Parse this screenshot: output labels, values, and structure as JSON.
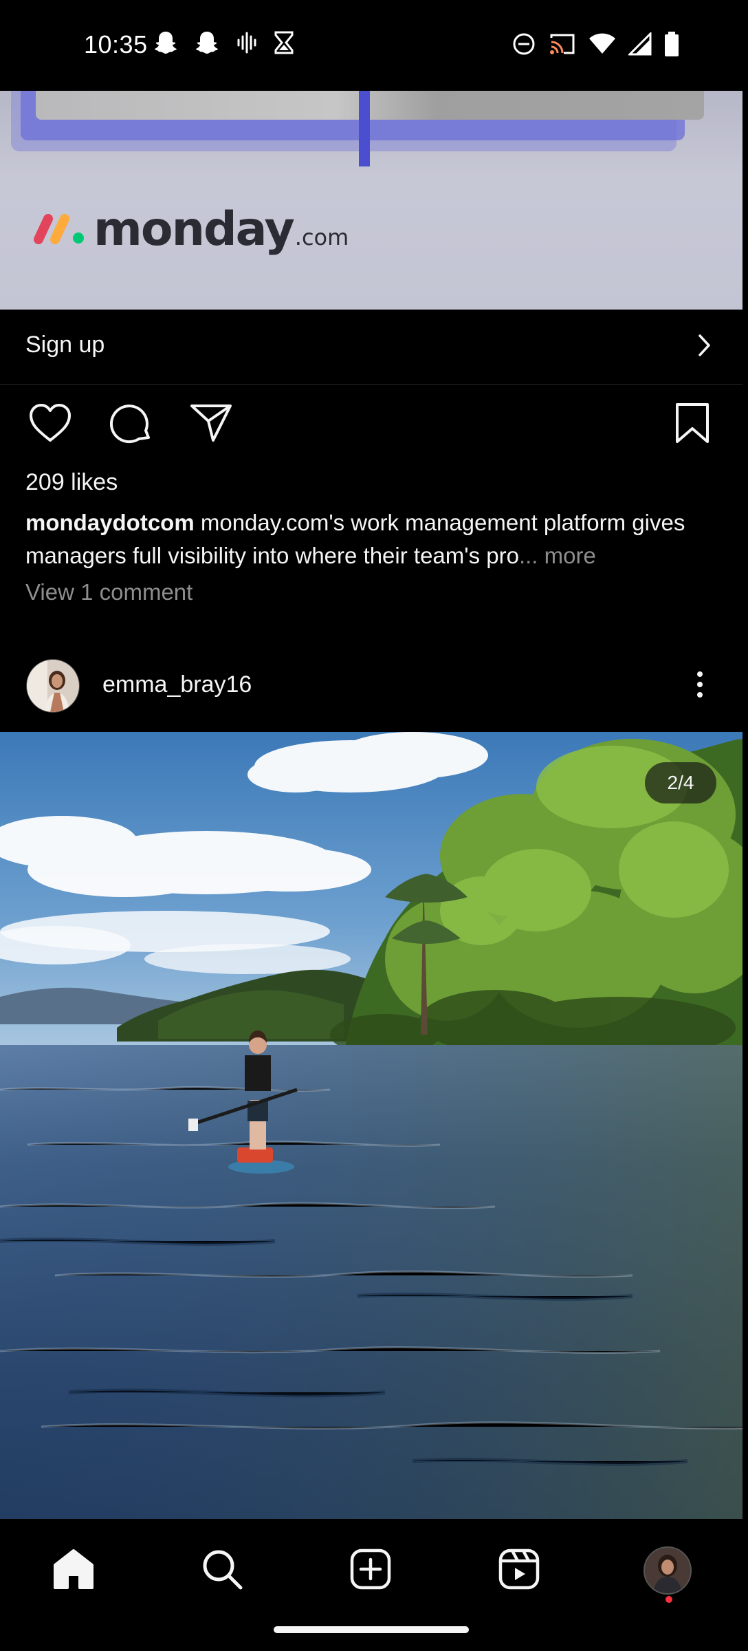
{
  "status_bar": {
    "time": "10:35",
    "left_icons": [
      "snapchat-icon",
      "snapchat-icon",
      "voice-recording-icon",
      "hourglass-icon"
    ],
    "right_icons": [
      "do-not-disturb-icon",
      "cast-icon",
      "wifi-icon",
      "cellular-signal-icon",
      "battery-icon"
    ]
  },
  "ad": {
    "logo_word": "monday",
    "logo_suffix": ".com",
    "logo_colors": [
      "#e2445c",
      "#fdab3d",
      "#00c875"
    ],
    "cta_label": "Sign up"
  },
  "post_actions": {
    "icons": [
      "heart-icon",
      "comment-icon",
      "share-icon",
      "bookmark-icon"
    ]
  },
  "ad_post": {
    "likes": "209 likes",
    "caption_user": "mondaydotcom",
    "caption_text": " monday.com's work management platform gives managers full visibility into where their team's pro",
    "caption_more": "... more",
    "view_comments": "View 1 comment"
  },
  "next_post": {
    "username": "emma_bray16",
    "image_counter": "2/4"
  },
  "bottom_nav": {
    "items": [
      "home-icon",
      "search-icon",
      "create-icon",
      "reels-icon",
      "profile-avatar"
    ],
    "active": "home-icon"
  }
}
